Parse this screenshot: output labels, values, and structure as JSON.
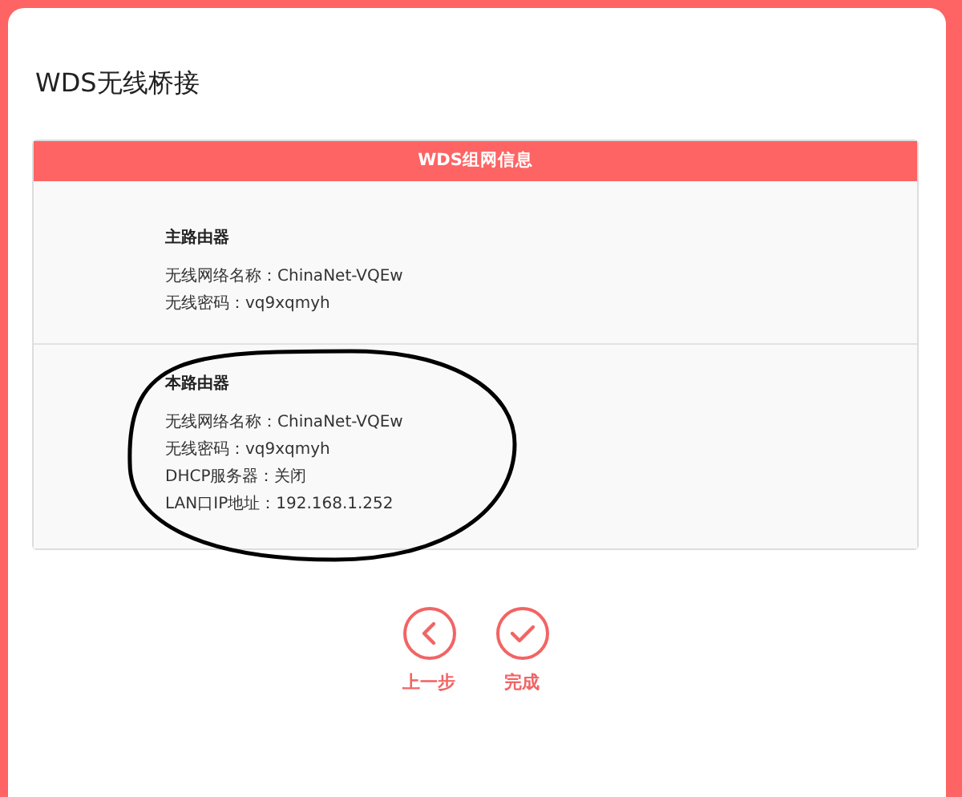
{
  "page_title": "WDS无线桥接",
  "panel": {
    "header": "WDS组网信息",
    "sections": [
      {
        "title": "主路由器",
        "lines": [
          "无线网络名称：ChinaNet-VQEw",
          "无线密码：vq9xqmyh"
        ],
        "circled": false
      },
      {
        "title": "本路由器",
        "lines": [
          "无线网络名称：ChinaNet-VQEw",
          "无线密码：vq9xqmyh",
          "DHCP服务器：关闭",
          "LAN口IP地址：192.168.1.252"
        ],
        "circled": true
      }
    ]
  },
  "buttons": [
    {
      "kind": "back",
      "label": "上一步"
    },
    {
      "kind": "done",
      "label": "完成"
    }
  ]
}
